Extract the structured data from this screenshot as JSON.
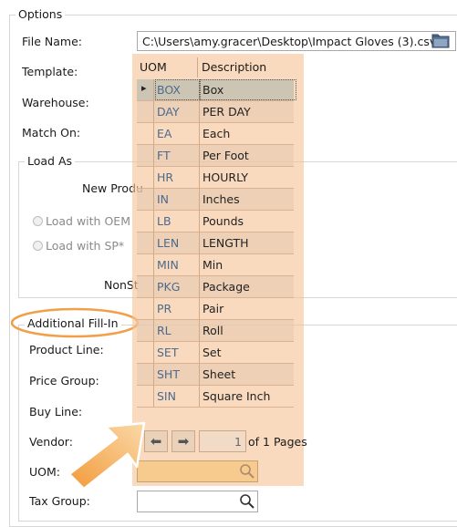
{
  "options": {
    "legend": "Options",
    "file_name_label": "File Name:",
    "file_name_value": "C:\\Users\\amy.gracer\\Desktop\\Impact Gloves (3).csv",
    "template_label": "Template:",
    "warehouse_label": "Warehouse:",
    "match_on_label": "Match On:"
  },
  "load_as": {
    "legend": "Load As",
    "new_product_label": "New Produ",
    "load_with_oem_label": "Load with OEM",
    "load_with_sp_label": "Load with SP*",
    "nonstock_label": "NonSt"
  },
  "fill_in": {
    "legend": "Additional Fill-In",
    "product_line_label": "Product Line:",
    "price_group_label": "Price Group:",
    "buy_line_label": "Buy Line:",
    "vendor_label": "Vendor:",
    "uom_label": "UOM:",
    "uom_value": "",
    "tax_group_label": "Tax Group:",
    "tax_group_value": ""
  },
  "uom_grid": {
    "header_uom": "UOM",
    "header_description": "Description",
    "selected_row_indicator": "▸",
    "rows": [
      {
        "uom": "BOX",
        "description": "Box"
      },
      {
        "uom": "DAY",
        "description": "PER DAY"
      },
      {
        "uom": "EA",
        "description": "Each"
      },
      {
        "uom": "FT",
        "description": "Per Foot"
      },
      {
        "uom": "HR",
        "description": "HOURLY"
      },
      {
        "uom": "IN",
        "description": "Inches"
      },
      {
        "uom": "LB",
        "description": "Pounds"
      },
      {
        "uom": "LEN",
        "description": "LENGTH"
      },
      {
        "uom": "MIN",
        "description": "Min"
      },
      {
        "uom": "PKG",
        "description": "Package"
      },
      {
        "uom": "PR",
        "description": "Pair"
      },
      {
        "uom": "RL",
        "description": "Roll"
      },
      {
        "uom": "SET",
        "description": "Set"
      },
      {
        "uom": "SHT",
        "description": "Sheet"
      },
      {
        "uom": "SIN",
        "description": "Square Inch"
      }
    ],
    "pager": {
      "prev_label": "⬅",
      "next_label": "➡",
      "current_page": "1",
      "of_pages_text": "of 1 Pages"
    }
  },
  "colors": {
    "popup_overlay": "#f6c496",
    "highlight_ring": "#f0a04a",
    "uom_field_bg": "#fad77e",
    "uom_code_text": "#4b6b8e"
  },
  "icons": [
    "folder-icon",
    "search-icon",
    "arrow-pointer-icon",
    "highlight-ellipse"
  ]
}
